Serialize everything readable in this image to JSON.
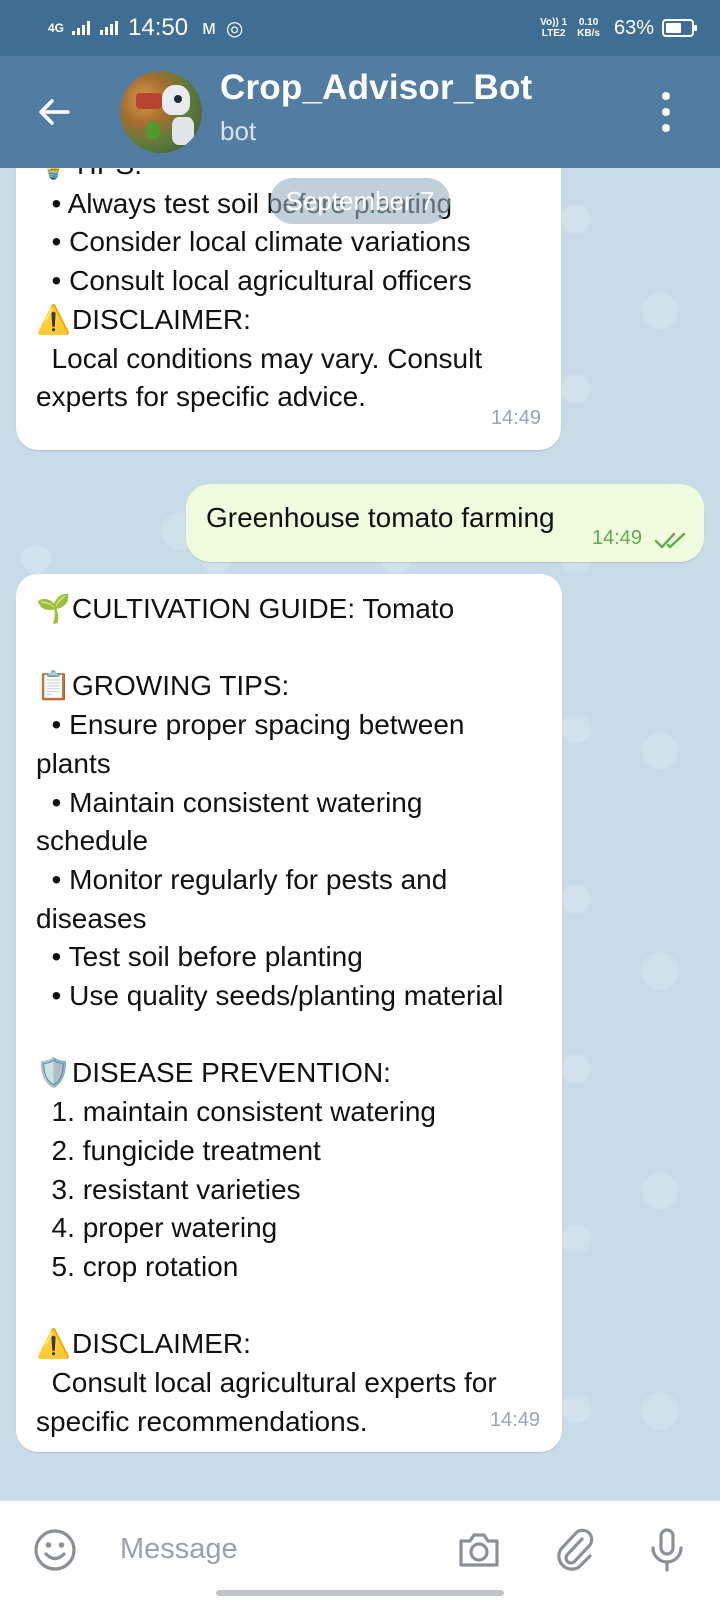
{
  "status_bar": {
    "network": "4G",
    "time": "14:50",
    "lte_label": "VoLTE2",
    "lte_top": "Vo)) 1",
    "lte_bottom": "LTE2",
    "speed_value": "0.10",
    "speed_unit": "KB/s",
    "battery": "63%",
    "battery_level": 0.63
  },
  "header": {
    "title": "Crop_Advisor_Bot",
    "subtitle": "bot"
  },
  "chat": {
    "date_pill": "September 7",
    "message1": {
      "lines": [
        "TIPS:",
        "  • Always test soil before planting",
        "  • Consider local climate variations",
        "  • Consult local agricultural officers",
        "",
        "DISCLAIMER:",
        "  Local conditions may vary. Consult",
        "experts for specific advice."
      ],
      "tips_emoji": "💡",
      "disclaimer_emoji": "⚠️",
      "time": "14:49"
    },
    "outgoing": {
      "text": "Greenhouse tomato farming",
      "time": "14:49"
    },
    "message2": {
      "emoji_guide": "🌱",
      "emoji_tips": "📋",
      "emoji_disease": "🛡️",
      "emoji_disclaimer": "⚠️",
      "lines": [
        "CULTIVATION GUIDE: Tomato",
        "",
        "GROWING TIPS:",
        "  • Ensure proper spacing between",
        "plants",
        "  • Maintain consistent watering",
        "schedule",
        "  • Monitor regularly for pests and",
        "diseases",
        "  • Test soil before planting",
        "  • Use quality seeds/planting material",
        "",
        "DISEASE PREVENTION:",
        "  1. maintain consistent watering",
        "  2. fungicide treatment",
        "  3. resistant varieties",
        "  4. proper watering",
        "  5. crop rotation",
        "",
        "DISCLAIMER:",
        "  Consult local agricultural experts for",
        "specific recommendations."
      ],
      "time": "14:49"
    }
  },
  "composer": {
    "placeholder": "Message"
  },
  "colors": {
    "status_bar": "#3e6e93",
    "app_bar": "#517da2",
    "chat_background": "#c7dce8",
    "outgoing_bubble": "#effdde",
    "outgoing_time": "#5cac4a"
  }
}
